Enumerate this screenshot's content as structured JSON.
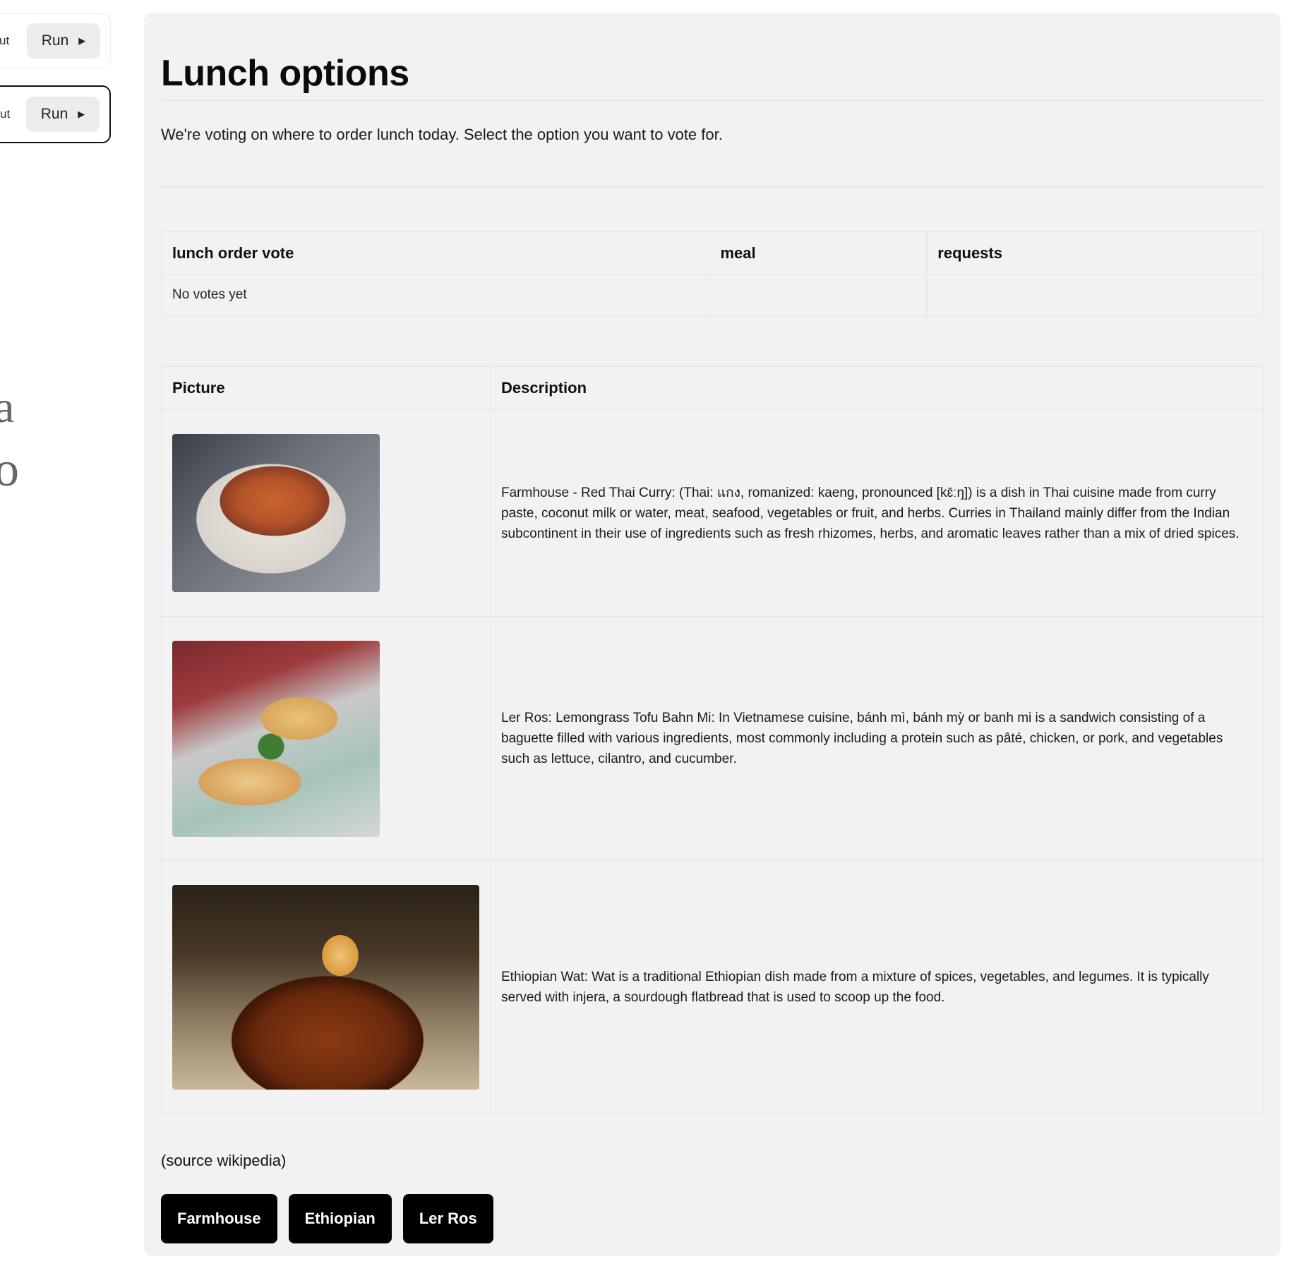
{
  "left_cells": [
    {
      "cut_text": "ut",
      "run_label": "Run",
      "run_icon": "play-triangle-icon"
    },
    {
      "cut_text": "ut",
      "run_label": "Run",
      "run_icon": "play-triangle-icon"
    }
  ],
  "side_glyphs": [
    "a",
    "o"
  ],
  "page": {
    "title": "Lunch options",
    "intro": "We're voting on where to order lunch today. Select the option you want to vote for."
  },
  "votes_table": {
    "headers": [
      "lunch order vote",
      "meal",
      "requests"
    ],
    "rows": [
      [
        "No votes yet",
        "",
        ""
      ]
    ]
  },
  "options_table": {
    "headers": [
      "Picture",
      "Description"
    ],
    "rows": [
      {
        "image": "red-thai-curry-photo",
        "description": "Farmhouse - Red Thai Curry: (Thai: แกง, romanized: kaeng, pronounced [kɛ̄ːŋ]) is a dish in Thai cuisine made from curry paste, coconut milk or water, meat, seafood, vegetables or fruit, and herbs. Curries in Thailand mainly differ from the Indian subcontinent in their use of ingredients such as fresh rhizomes, herbs, and aromatic leaves rather than a mix of dried spices."
      },
      {
        "image": "banh-mi-photo",
        "description": "Ler Ros: Lemongrass Tofu Bahn Mi: In Vietnamese cuisine, bánh mì, bánh mỳ or banh mi is a sandwich consisting of a baguette filled with various ingredients, most commonly including a protein such as pâté, chicken, or pork, and vegetables such as lettuce, cilantro, and cucumber."
      },
      {
        "image": "ethiopian-wat-photo",
        "description": "Ethiopian Wat: Wat is a traditional Ethiopian dish made from a mixture of spices, vegetables, and legumes. It is typically served with injera, a sourdough flatbread that is used to scoop up the food."
      }
    ]
  },
  "source_note": "(source wikipedia)",
  "vote_buttons": [
    "Farmhouse",
    "Ethiopian",
    "Ler Ros"
  ]
}
